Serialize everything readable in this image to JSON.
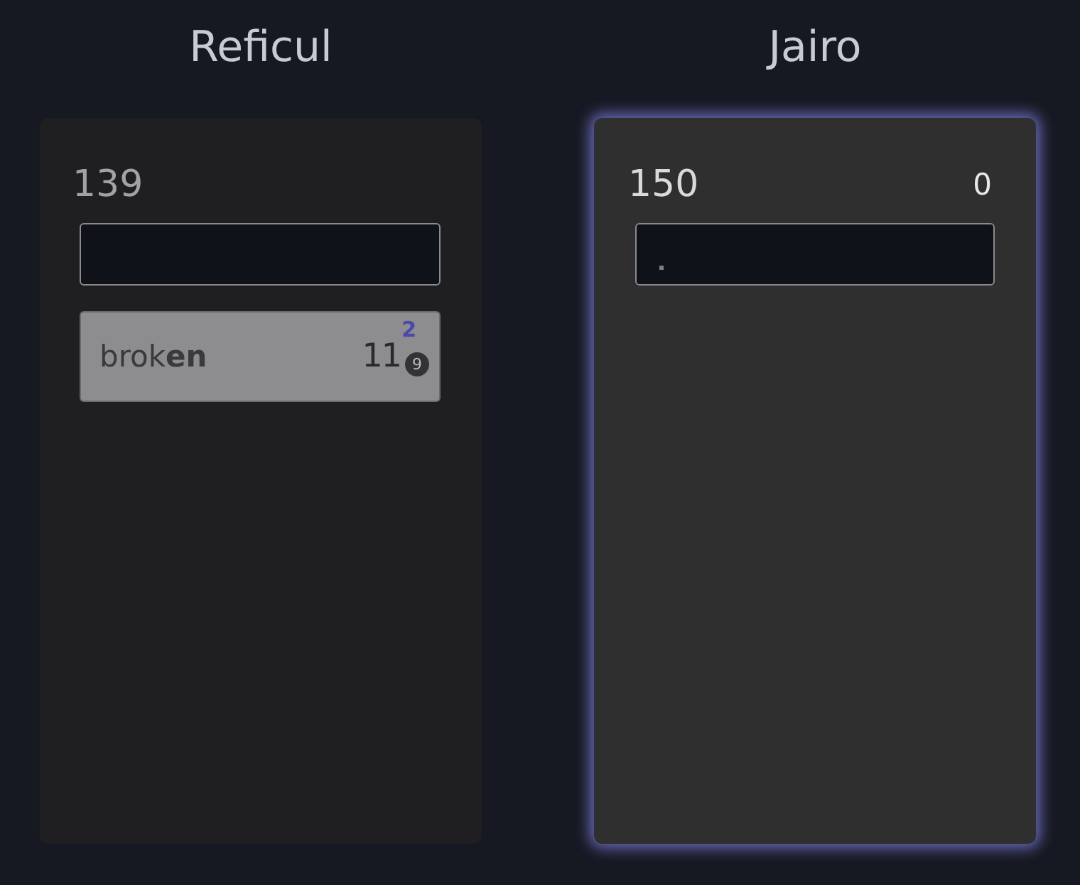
{
  "players": [
    {
      "name": "Reficul",
      "total": "139",
      "active": false,
      "words": [
        {
          "text": "brok**en**",
          "points": "11",
          "bonus": "2",
          "badge": "9"
        }
      ]
    },
    {
      "name": "Jairo",
      "total": "150",
      "active": true,
      "score": "0"
    }
  ]
}
